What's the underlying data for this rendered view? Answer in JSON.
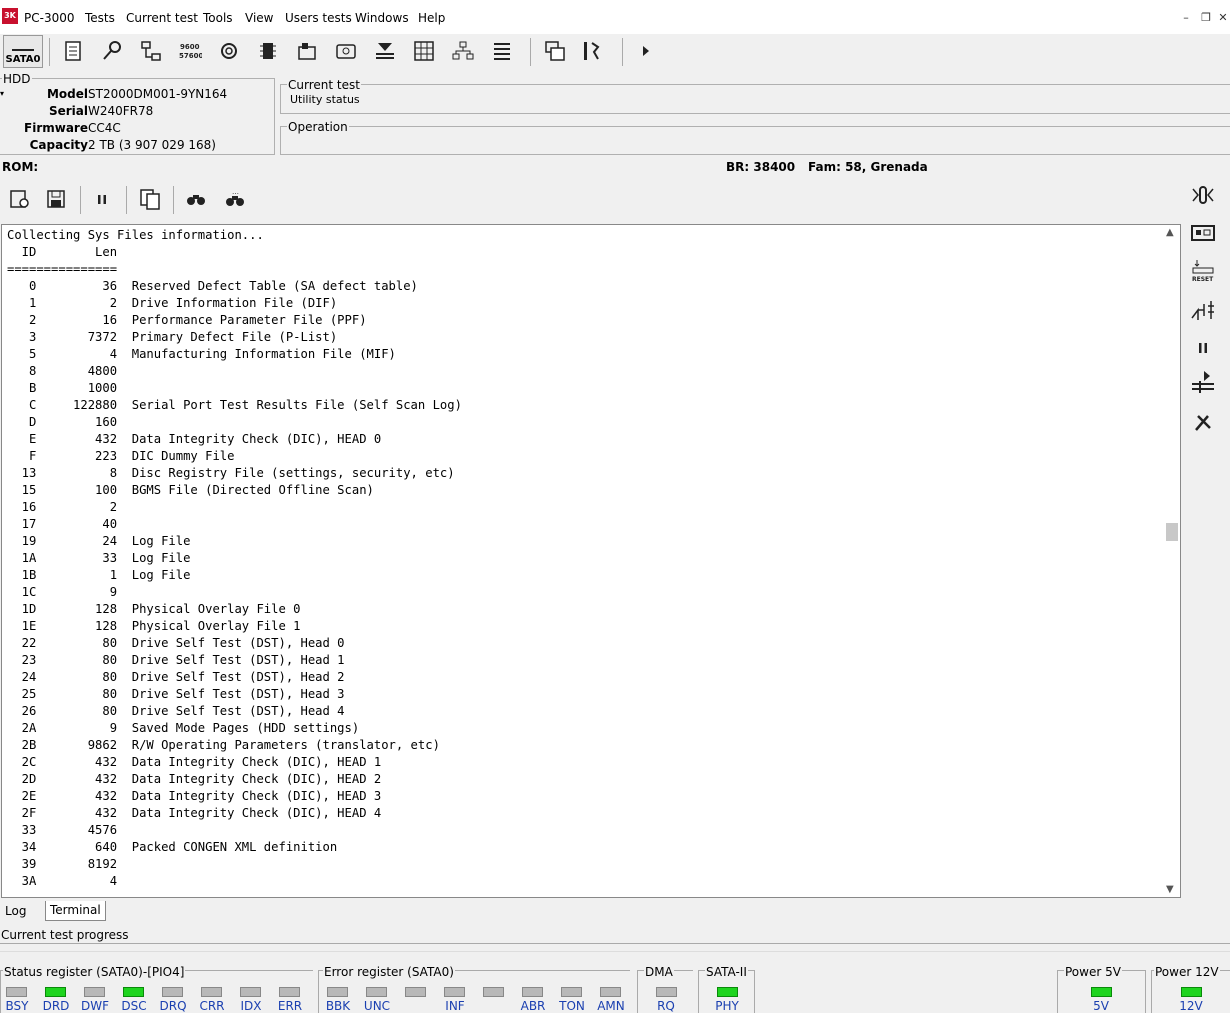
{
  "app": {
    "title": "PC-3000",
    "logo_text": "3K"
  },
  "menu": [
    "Tests",
    "Current test",
    "Tools",
    "View",
    "Users tests",
    "Windows",
    "Help"
  ],
  "toolbar": {
    "port_label": "SATA0"
  },
  "hdd": {
    "legend": "HDD",
    "model_label": "Model",
    "model": "ST2000DM001-9YN164",
    "serial_label": "Serial",
    "serial": "W240FR78",
    "firmware_label": "Firmware",
    "firmware": "CC4C",
    "capacity_label": "Capacity",
    "capacity": "2 TB (3 907 029 168)"
  },
  "current_test": {
    "legend": "Current test",
    "status": "Utility status"
  },
  "operation": {
    "legend": "Operation"
  },
  "rom": {
    "label": "ROM:",
    "br": "BR: 38400",
    "fam": "Fam: 58, Grenada"
  },
  "log": {
    "lines": [
      "Collecting Sys Files information...",
      "  ID        Len",
      "===============",
      "   0         36  Reserved Defect Table (SA defect table)",
      "   1          2  Drive Information File (DIF)",
      "   2         16  Performance Parameter File (PPF)",
      "   3       7372  Primary Defect File (P-List)",
      "   5          4  Manufacturing Information File (MIF)",
      "   8       4800",
      "   B       1000",
      "   C     122880  Serial Port Test Results File (Self Scan Log)",
      "   D        160",
      "   E        432  Data Integrity Check (DIC), HEAD 0",
      "   F        223  DIC Dummy File",
      "  13          8  Disc Registry File (settings, security, etc)",
      "  15        100  BGMS File (Directed Offline Scan)",
      "  16          2",
      "  17         40",
      "  19         24  Log File",
      "  1A         33  Log File",
      "  1B          1  Log File",
      "  1C          9",
      "  1D        128  Physical Overlay File 0",
      "  1E        128  Physical Overlay File 1",
      "  22         80  Drive Self Test (DST), Head 0",
      "  23         80  Drive Self Test (DST), Head 1",
      "  24         80  Drive Self Test (DST), Head 2",
      "  25         80  Drive Self Test (DST), Head 3",
      "  26         80  Drive Self Test (DST), Head 4",
      "  2A          9  Saved Mode Pages (HDD settings)",
      "  2B       9862  R/W Operating Parameters (translator, etc)",
      "  2C        432  Data Integrity Check (DIC), HEAD 1",
      "  2D        432  Data Integrity Check (DIC), HEAD 2",
      "  2E        432  Data Integrity Check (DIC), HEAD 3",
      "  2F        432  Data Integrity Check (DIC), HEAD 4",
      "  33       4576",
      "  34        640  Packed CONGEN XML definition",
      "  39       8192",
      "  3A          4"
    ]
  },
  "tabs": {
    "log": "Log",
    "terminal": "Terminal"
  },
  "progress": {
    "label": "Current test progress"
  },
  "status_register": {
    "title": "Status register (SATA0)-[PIO4]",
    "leds": [
      {
        "name": "BSY",
        "on": false
      },
      {
        "name": "DRD",
        "on": true
      },
      {
        "name": "DWF",
        "on": false
      },
      {
        "name": "DSC",
        "on": true
      },
      {
        "name": "DRQ",
        "on": false
      },
      {
        "name": "CRR",
        "on": false
      },
      {
        "name": "IDX",
        "on": false
      },
      {
        "name": "ERR",
        "on": false
      }
    ]
  },
  "error_register": {
    "title": "Error register (SATA0)",
    "leds": [
      {
        "name": "BBK",
        "on": false
      },
      {
        "name": "UNC",
        "on": false
      },
      {
        "name": "",
        "on": false
      },
      {
        "name": "INF",
        "on": false
      },
      {
        "name": "",
        "on": false
      },
      {
        "name": "ABR",
        "on": false
      },
      {
        "name": "TON",
        "on": false
      },
      {
        "name": "AMN",
        "on": false
      }
    ]
  },
  "dma": {
    "title": "DMA",
    "led": "RQ",
    "on": false
  },
  "sata2": {
    "title": "SATA-II",
    "led": "PHY",
    "on": true
  },
  "power5": {
    "title": "Power 5V",
    "led": "5V",
    "on": true
  },
  "power12": {
    "title": "Power 12V",
    "led": "12V",
    "on": true
  },
  "colors": {
    "led_on": "#1ed41e",
    "led_off": "#b8b8b8",
    "label_blue": "#1a3fb0"
  }
}
